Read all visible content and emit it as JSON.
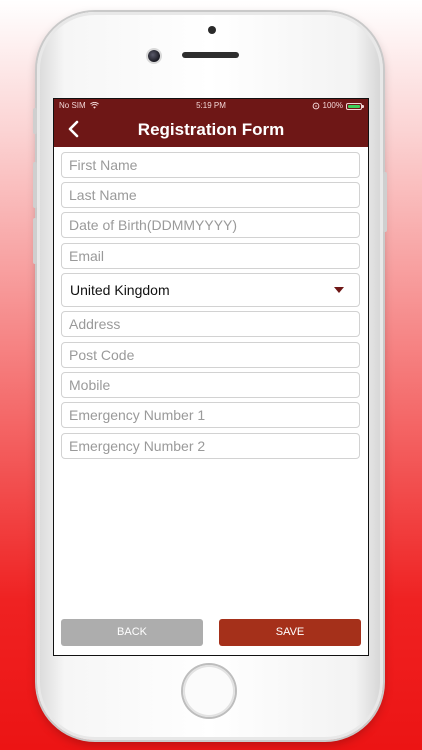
{
  "status_bar": {
    "carrier": "No SIM",
    "time": "5:19 PM",
    "battery_text": "100%",
    "battery_level": 1.0,
    "battery_color": "#3fd15a"
  },
  "nav": {
    "title": "Registration Form",
    "back_icon": "chevron-left-icon"
  },
  "form": {
    "first_name": {
      "placeholder": "First Name",
      "value": ""
    },
    "last_name": {
      "placeholder": "Last Name",
      "value": ""
    },
    "dob": {
      "placeholder": "Date of Birth(DDMMYYYY)",
      "value": ""
    },
    "email": {
      "placeholder": "Email",
      "value": ""
    },
    "country": {
      "selected": "United Kingdom",
      "icon": "caret-down-icon"
    },
    "address": {
      "placeholder": "Address",
      "value": ""
    },
    "post_code": {
      "placeholder": "Post Code",
      "value": ""
    },
    "mobile": {
      "placeholder": "Mobile",
      "value": ""
    },
    "emergency_1": {
      "placeholder": "Emergency Number 1",
      "value": ""
    },
    "emergency_2": {
      "placeholder": "Emergency Number 2",
      "value": ""
    }
  },
  "buttons": {
    "back_label": "BACK",
    "save_label": "SAVE"
  },
  "colors": {
    "header": "#6e1716",
    "save_button": "#a5301a",
    "back_button": "#adadad"
  }
}
